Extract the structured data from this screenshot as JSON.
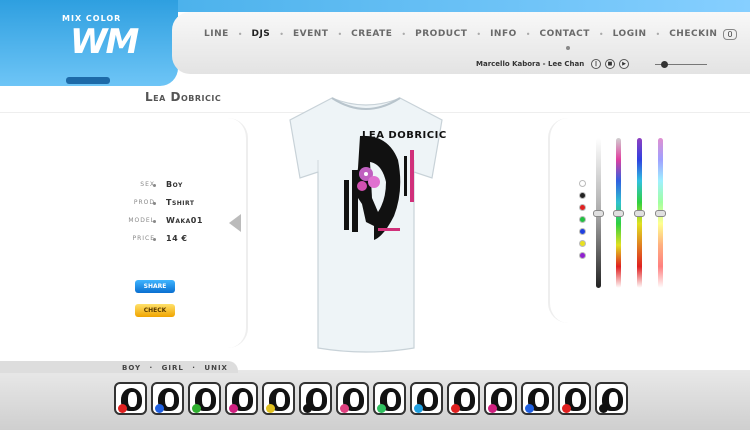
{
  "brand": {
    "small_title": "MIX COLOR",
    "logo_text": "WM",
    "tagline": "",
    "colors": {
      "primary_blue": "#2e9fe0",
      "light_blue": "#86cfff",
      "share_blue": "#0a6fd0",
      "check_yellow": "#f0a400"
    }
  },
  "nav": {
    "items": [
      {
        "label": "LINE",
        "active": false
      },
      {
        "label": "DJS",
        "active": true
      },
      {
        "label": "EVENT",
        "active": false
      },
      {
        "label": "CREATE",
        "active": false
      },
      {
        "label": "PRODUCT",
        "active": false
      },
      {
        "label": "INFO",
        "active": false
      },
      {
        "label": "CONTACT",
        "active": false
      },
      {
        "label": "LOGIN",
        "active": false
      },
      {
        "label": "CHECKIN",
        "active": false
      }
    ],
    "cart_count": "0"
  },
  "player": {
    "track": "Marcello Kabora - Lee Chan",
    "buttons": [
      "prev-icon",
      "pause-icon",
      "play-icon"
    ]
  },
  "product": {
    "artist": "Lea Dobricic",
    "print_text": "LEA DOBRICIC",
    "details": [
      {
        "label": "SEX",
        "value": "Boy"
      },
      {
        "label": "PROD",
        "value": "Tshirt"
      },
      {
        "label": "MODEL",
        "value": "Waka01"
      },
      {
        "label": "PRICE",
        "value": "14 €"
      }
    ],
    "share_label": "SHARE",
    "check_label": "CHECK"
  },
  "colors_panel": {
    "swatches": [
      "#ffffff",
      "#222222",
      "#e02020",
      "#22c040",
      "#2040e0",
      "#e8e020",
      "#9020d0"
    ]
  },
  "filter": {
    "options": [
      "BOY",
      "GIRL",
      "UNIX"
    ],
    "separator": "·"
  },
  "gallery": {
    "thumbs": [
      {
        "accent": "#e02020"
      },
      {
        "accent": "#2060e0"
      },
      {
        "accent": "#30b030"
      },
      {
        "accent": "#d02080"
      },
      {
        "accent": "#e0c020"
      },
      {
        "accent": "#111111"
      },
      {
        "accent": "#e04080"
      },
      {
        "accent": "#30c060"
      },
      {
        "accent": "#20a0e0"
      },
      {
        "accent": "#e02020"
      },
      {
        "accent": "#d02080"
      },
      {
        "accent": "#2060e0"
      },
      {
        "accent": "#e02020"
      },
      {
        "accent": "#111111"
      }
    ]
  }
}
